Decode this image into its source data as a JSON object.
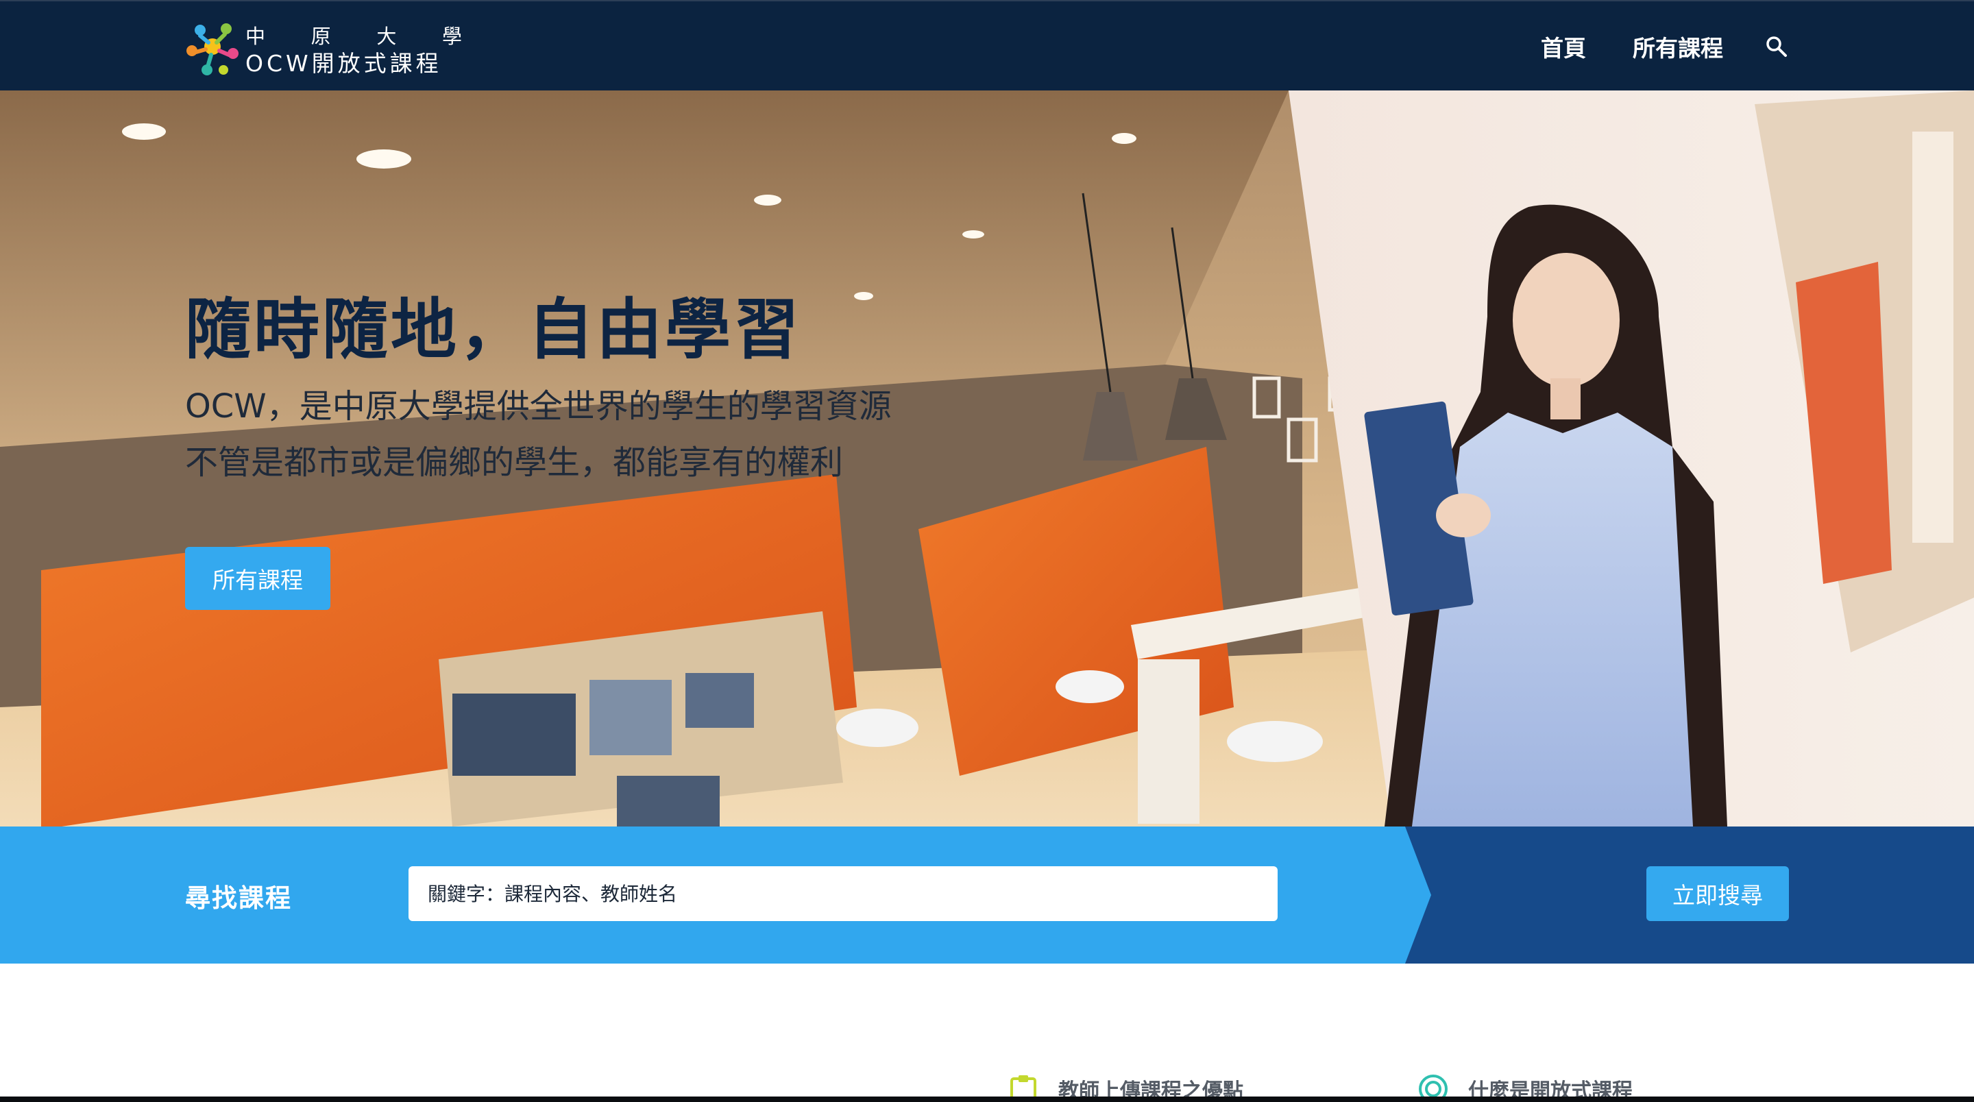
{
  "header": {
    "logo": {
      "line1": [
        "中",
        "原",
        "大",
        "學"
      ],
      "line2": "OCW開放式課程"
    },
    "nav": [
      {
        "label": "首頁"
      },
      {
        "label": "所有課程"
      }
    ],
    "search_icon": "search-icon"
  },
  "hero": {
    "title": "隨時隨地，自由學習",
    "subtitle_lines": [
      "OCW，是中原大學提供全世界的學生的學習資源",
      "不管是都市或是偏鄉的學生，都能享有的權利"
    ],
    "button_label": "所有課程"
  },
  "search": {
    "label": "尋找課程",
    "placeholder": "關鍵字：課程內容、教師姓名",
    "value": "",
    "button_label": "立即搜尋"
  },
  "features": [
    {
      "icon": "clipboard-icon",
      "label": "教師上傳課程之優點"
    },
    {
      "icon": "target-icon",
      "label": "什麼是開放式課程"
    }
  ],
  "colors": {
    "header_bg": "#0b2340",
    "accent": "#34a9ef",
    "band_dark": "#164a8a",
    "title": "#0d2443"
  }
}
